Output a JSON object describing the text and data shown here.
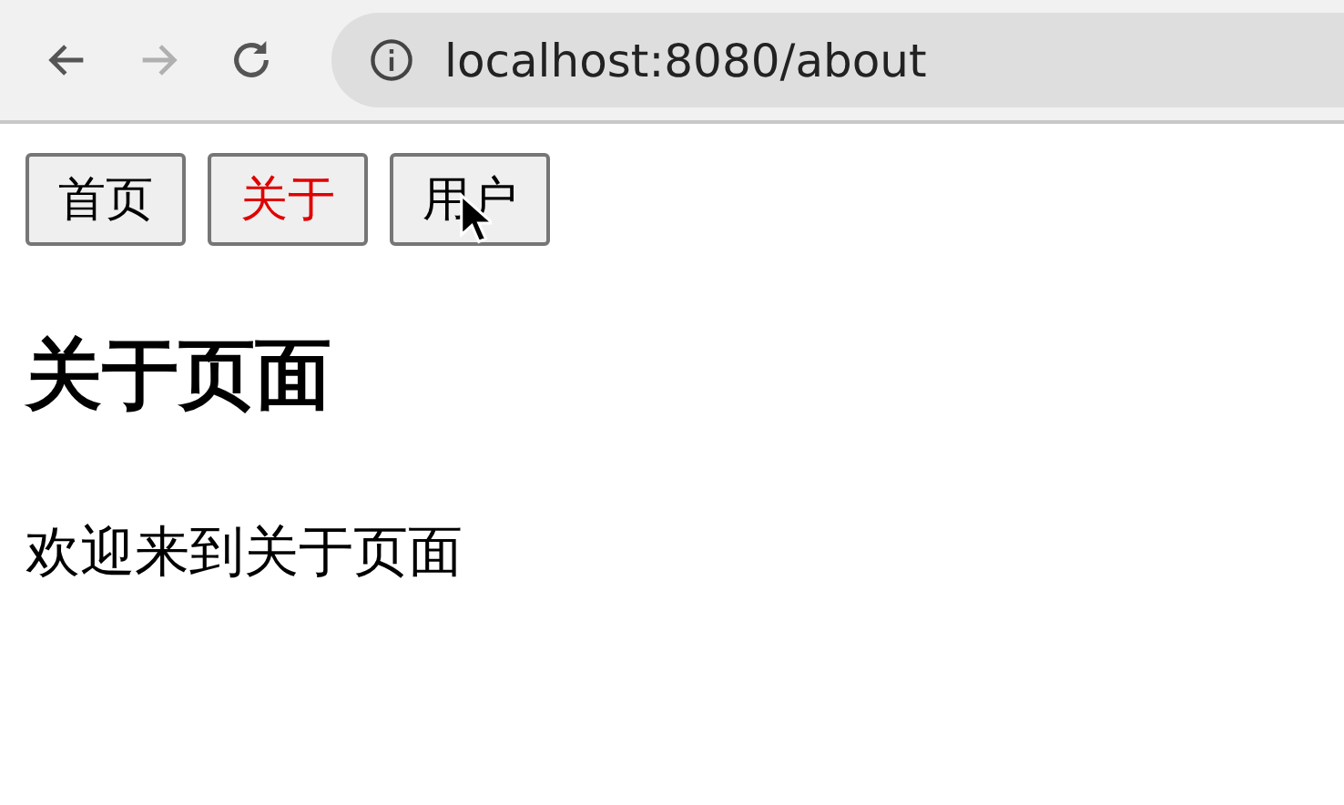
{
  "browser": {
    "back_disabled": false,
    "forward_disabled": true,
    "url": "localhost:8080/about"
  },
  "nav": [
    {
      "label": "首页",
      "selected": false
    },
    {
      "label": "关于",
      "selected": true
    },
    {
      "label": "用户",
      "selected": false
    }
  ],
  "heading": "关于页面",
  "paragraph": "欢迎来到关于页面"
}
